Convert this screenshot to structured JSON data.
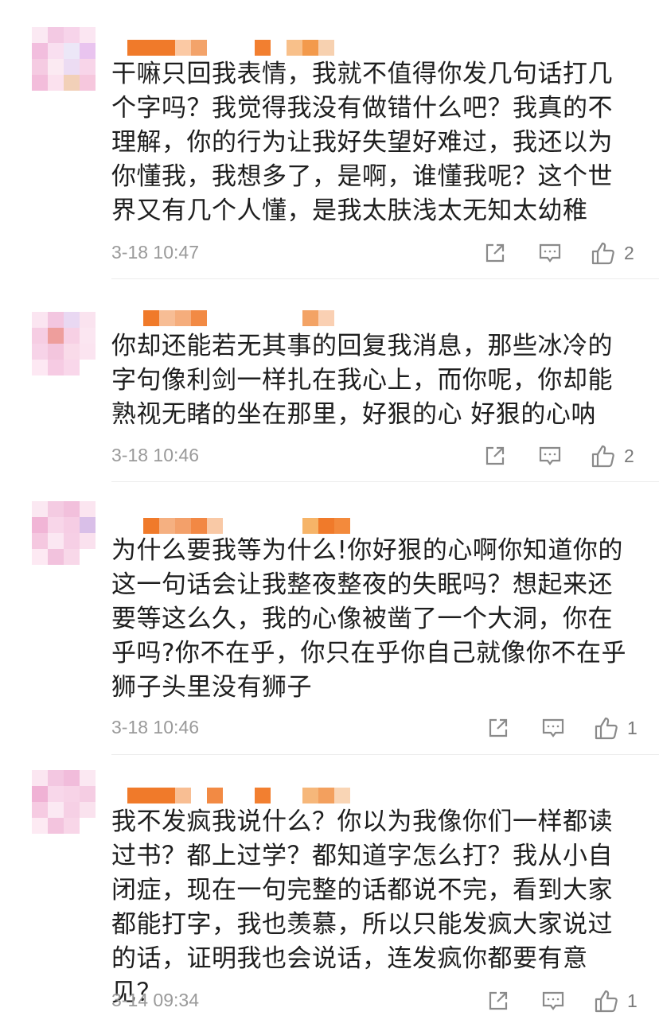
{
  "comments": [
    {
      "text": "干嘛只回我表情，我就不值得你发几句话打几个字吗？我觉得我没有做错什么吧？我真的不理解，你的行为让我好失望好难过，我还以为你懂我，我想多了，是啊，谁懂我呢？这个世界又有几个人懂，是我太肤浅太无知太幼稚",
      "time": "3-18 10:47",
      "likes": "2"
    },
    {
      "text": "你却还能若无其事的回复我消息，那些冰冷的字句像利剑一样扎在我心上，而你呢，你却能熟视无睹的坐在那里，好狠的心 好狠的心呐",
      "time": "3-18 10:46",
      "likes": "2"
    },
    {
      "text": "为什么要我等为什么!你好狠的心啊你知道你的这一句话会让我整夜整夜的失眠吗？想起来还要等这么久，我的心像被凿了一个大洞，你在乎吗?你不在乎，你只在乎你自己就像你不在乎狮子头里没有狮子",
      "time": "3-18 10:46",
      "likes": "1"
    },
    {
      "text": "我不发疯我说什么？你以为我像你们一样都读过书？都上过学？都知道字怎么打？我从小自闭症，现在一句完整的话都说不完，看到大家都能打字，我也羡慕，所以只能发疯大家说过的话，证明我也会说话，连发疯你都要有意见？",
      "time": "3-14 09:34",
      "likes": "1"
    }
  ],
  "icons": {
    "share": "share-icon",
    "comment": "comment-icon",
    "like": "thumbs-up-icon"
  },
  "colors": {
    "username_blur": "#f07a2a",
    "avatar_blur": "#f2c8e0",
    "timestamp": "#9a9a9a",
    "icon": "#8a8a8a"
  }
}
